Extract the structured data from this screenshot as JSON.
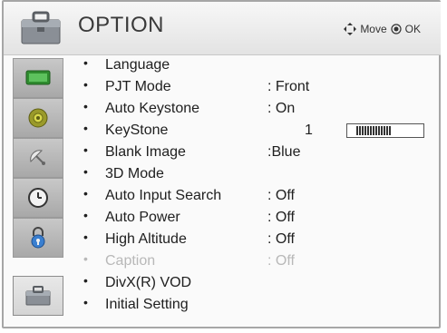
{
  "header": {
    "title": "OPTION",
    "hint_move": "Move",
    "hint_ok": "OK"
  },
  "sidebar": {
    "items": [
      {
        "icon": "picture-icon",
        "active": false
      },
      {
        "icon": "audio-icon",
        "active": false
      },
      {
        "icon": "satellite-icon",
        "active": false
      },
      {
        "icon": "clock-icon",
        "active": false
      },
      {
        "icon": "lock-icon",
        "active": false
      },
      {
        "icon": "option-icon",
        "active": true
      }
    ]
  },
  "menu": {
    "items": [
      {
        "label": "Language",
        "value": ""
      },
      {
        "label": "PJT Mode",
        "value": ": Front"
      },
      {
        "label": "Auto Keystone",
        "value": ": On"
      },
      {
        "label": "KeyStone",
        "value": "1",
        "slider_level": 0.5
      },
      {
        "label": "Blank Image",
        "value": ":Blue"
      },
      {
        "label": "3D Mode",
        "value": ""
      },
      {
        "label": "Auto Input Search",
        "value": ": Off"
      },
      {
        "label": "Auto Power",
        "value": ": Off"
      },
      {
        "label": "High Altitude",
        "value": ": Off"
      },
      {
        "label": "Caption",
        "value": ": Off",
        "disabled": true
      },
      {
        "label": "DivX(R) VOD",
        "value": ""
      },
      {
        "label": "Initial Setting",
        "value": ""
      }
    ]
  },
  "colors": {
    "frame_border": "#a6a6a6",
    "sidebar_bg": "#b4b4b4",
    "disabled_text": "#b8b8b8"
  }
}
